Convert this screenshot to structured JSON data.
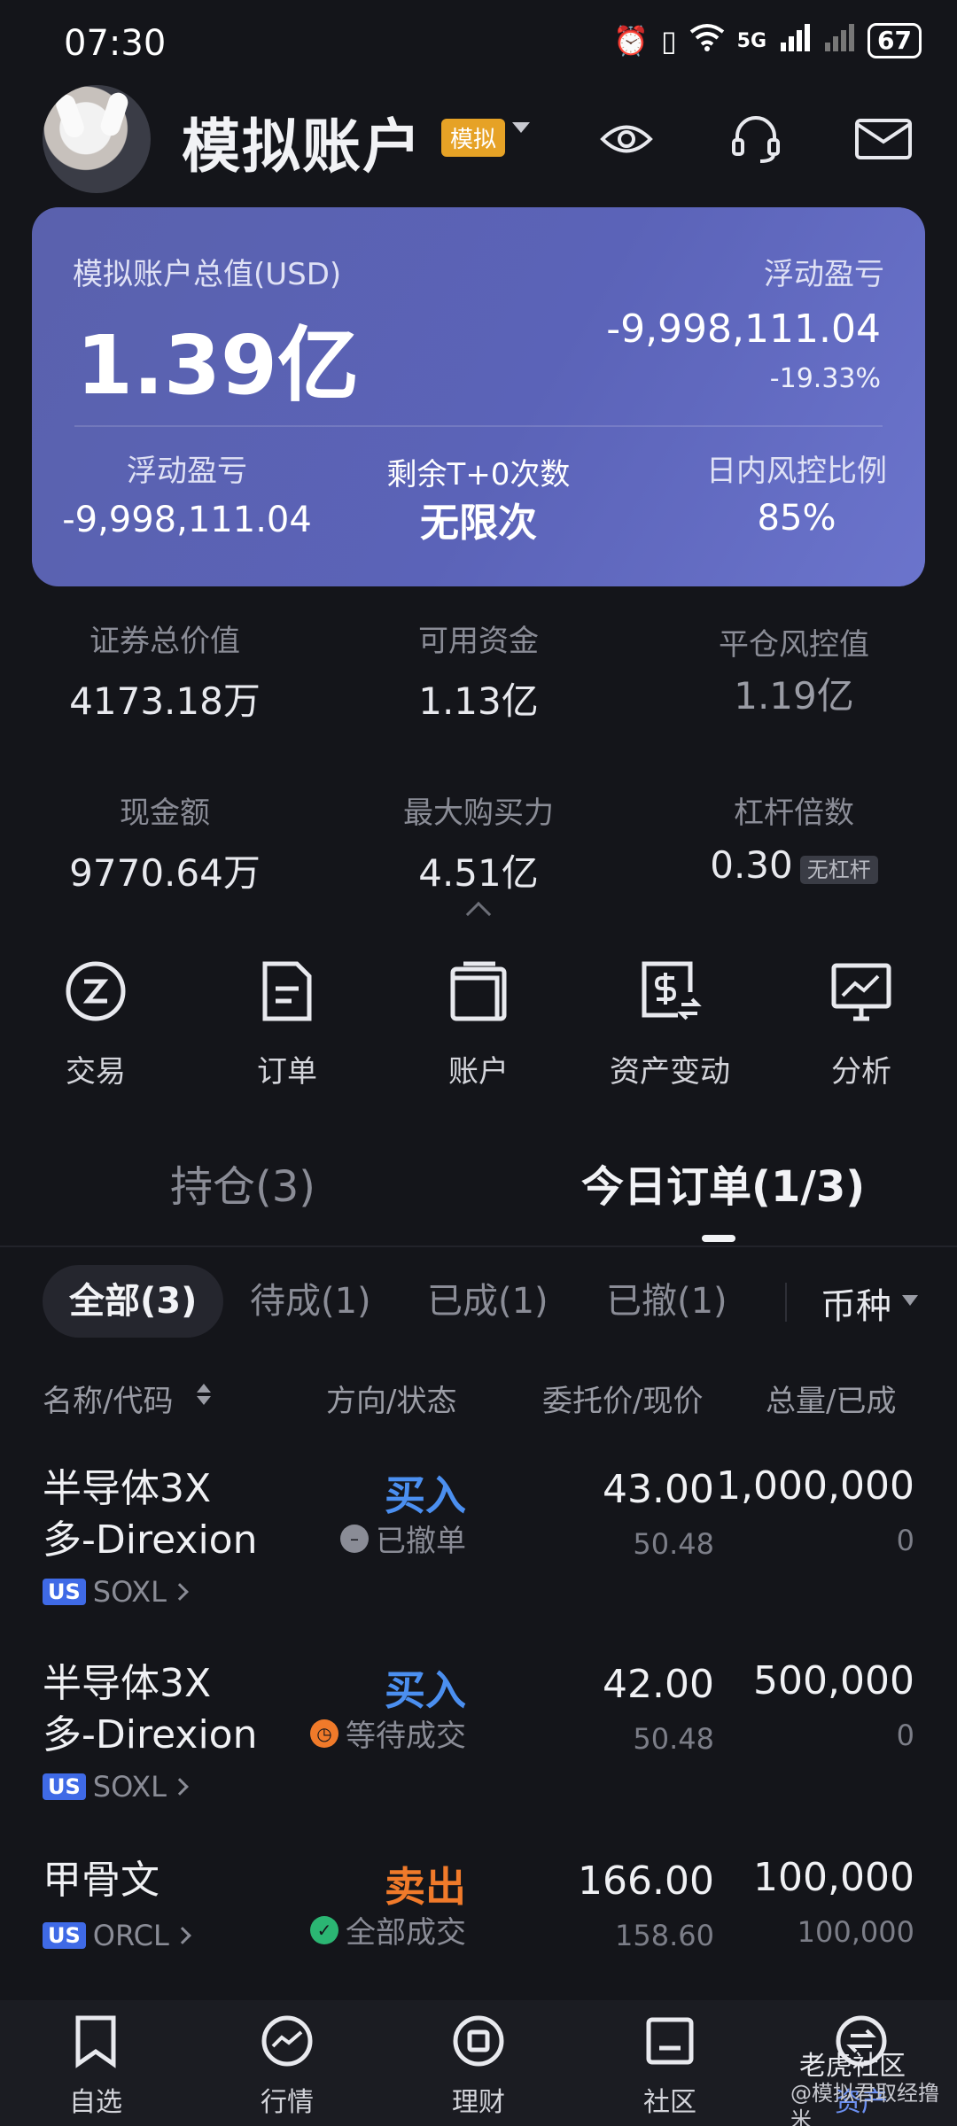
{
  "status_bar": {
    "time": "07:30",
    "battery": "67",
    "network": "5G"
  },
  "header": {
    "title": "模拟账户",
    "badge": "模拟"
  },
  "summary": {
    "total_label": "模拟账户总值(USD)",
    "total_value": "1.39亿",
    "floating_label": "浮动盈亏",
    "floating_value": "-9,998,111.04",
    "floating_pct": "-19.33%",
    "stats": [
      {
        "label": "浮动盈亏",
        "value": "-9,998,111.04"
      },
      {
        "label": "剩余T+0次数",
        "value": "无限次"
      },
      {
        "label": "日内风控比例",
        "value": "85%"
      }
    ]
  },
  "metrics": [
    {
      "label": "证券总价值",
      "value": "4173.18万"
    },
    {
      "label": "可用资金",
      "value": "1.13亿"
    },
    {
      "label": "平仓风控值",
      "value": "1.19亿"
    },
    {
      "label": "现金额",
      "value": "9770.64万"
    },
    {
      "label": "最大购买力",
      "value": "4.51亿"
    },
    {
      "label": "杠杆倍数",
      "value": "0.30",
      "tag": "无杠杆"
    }
  ],
  "actions": [
    {
      "label": "交易",
      "icon": "trade-icon"
    },
    {
      "label": "订单",
      "icon": "order-icon"
    },
    {
      "label": "账户",
      "icon": "wallet-icon"
    },
    {
      "label": "资产变动",
      "icon": "asset-change-icon"
    },
    {
      "label": "分析",
      "icon": "analysis-icon"
    }
  ],
  "tabs": [
    {
      "label": "持仓(3)"
    },
    {
      "label": "今日订单(1/3)"
    }
  ],
  "filters": [
    "全部(3)",
    "待成(1)",
    "已成(1)",
    "已撤(1)"
  ],
  "currency_label": "币种",
  "table_headers": [
    "名称/代码",
    "方向/状态",
    "委托价/现价",
    "总量/已成"
  ],
  "orders": [
    {
      "name_line1": "半导体3X",
      "name_line2": "多-Direxion",
      "market": "US",
      "code": "SOXL",
      "direction": "买入",
      "status": "已撤单",
      "order_price": "43.00",
      "current_price": "50.48",
      "total": "1,000,000",
      "filled": "0"
    },
    {
      "name_line1": "半导体3X",
      "name_line2": "多-Direxion",
      "market": "US",
      "code": "SOXL",
      "direction": "买入",
      "status": "等待成交",
      "order_price": "42.00",
      "current_price": "50.48",
      "total": "500,000",
      "filled": "0"
    },
    {
      "name_line1": "甲骨文",
      "name_line2": "",
      "market": "US",
      "code": "ORCL",
      "direction": "卖出",
      "status": "全部成交",
      "order_price": "166.00",
      "current_price": "158.60",
      "total": "100,000",
      "filled": "100,000"
    }
  ],
  "bottom_nav": [
    "自选",
    "行情",
    "理财",
    "社区",
    "资产"
  ],
  "watermark": {
    "brand": "老虎社区",
    "text": "@模拟君取经撸米"
  },
  "colors": {
    "card": "#5b63b8",
    "buy": "#4b8ff0",
    "sell": "#f07a2a",
    "badge": "#e6a226",
    "market_tag": "#3f6ae6"
  }
}
